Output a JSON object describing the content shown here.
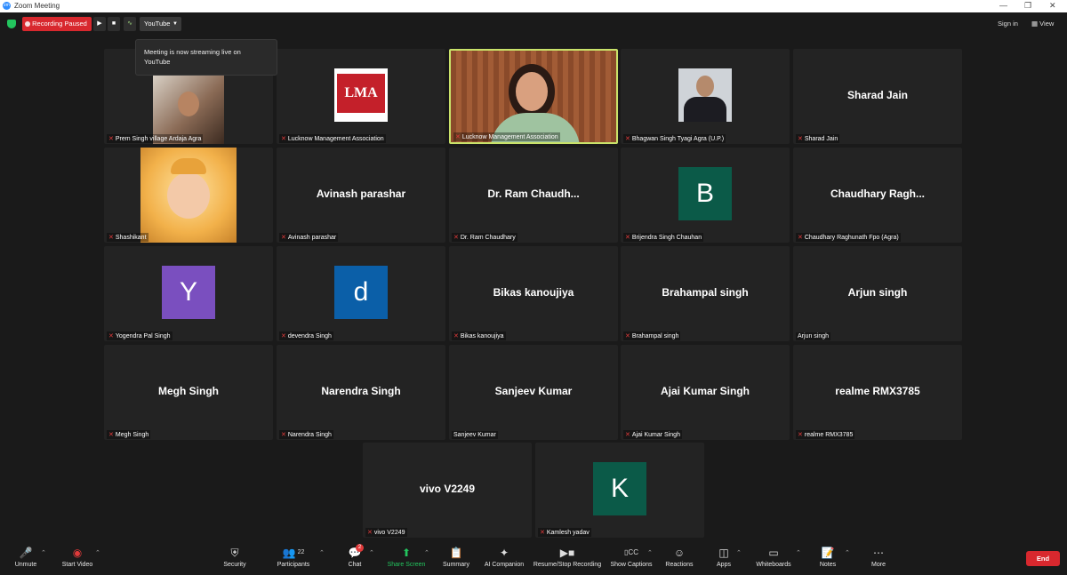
{
  "window": {
    "title": "Zoom Meeting",
    "app_icon": "zoom-icon",
    "app_icon_text": "zm"
  },
  "topbar": {
    "recording_label": "Recording Paused",
    "stream_target": "YouTube",
    "sign_in": "Sign in",
    "view": "View"
  },
  "tooltip": {
    "text": "Meeting is now streaming live on YouTube"
  },
  "tiles": [
    {
      "caption": "Prem Singh village Ardaja Agra",
      "big_name": "",
      "kind": "photo-man"
    },
    {
      "caption": "Lucknow Management Association",
      "big_name": "",
      "kind": "lma-logo",
      "logo_text": "LMA"
    },
    {
      "caption": "Lucknow Management Association",
      "big_name": "",
      "kind": "video-woman",
      "speaking": true
    },
    {
      "caption": "Bhagwan Singh Tyagi  Agra (U.P.)",
      "big_name": "",
      "kind": "photo-suit"
    },
    {
      "caption": "Sharad Jain",
      "big_name": "Sharad Jain"
    },
    {
      "caption": "Shashikant",
      "big_name": "",
      "kind": "photo-krishna"
    },
    {
      "caption": "Avinash parashar",
      "big_name": "Avinash parashar"
    },
    {
      "caption": "Dr. Ram Chaudhary",
      "big_name": "Dr. Ram  Chaudh..."
    },
    {
      "caption": "Brijendra Singh Chauhan",
      "big_name": "",
      "letter": "B",
      "letter_color": "#0b5a48"
    },
    {
      "caption": "Chaudhary Raghunath Fpo (Agra)",
      "big_name": "Chaudhary  Ragh..."
    },
    {
      "caption": "Yogendra Pal Singh",
      "big_name": "",
      "letter": "Y",
      "letter_color": "#7a4fbf"
    },
    {
      "caption": "devendra Singh",
      "big_name": "",
      "letter": "d",
      "letter_color": "#0b5fa8"
    },
    {
      "caption": "Bikas kanoujiya",
      "big_name": "Bikas kanoujiya"
    },
    {
      "caption": "Brahampal singh",
      "big_name": "Brahampal singh"
    },
    {
      "caption": "Arjun singh",
      "big_name": "Arjun singh",
      "no_mic": true
    },
    {
      "caption": "Megh Singh",
      "big_name": "Megh Singh"
    },
    {
      "caption": "Narendra Singh",
      "big_name": "Narendra Singh"
    },
    {
      "caption": "Sanjeev Kumar",
      "big_name": "Sanjeev Kumar",
      "no_mic": true
    },
    {
      "caption": "Ajai Kumar Singh",
      "big_name": "Ajai Kumar Singh"
    },
    {
      "caption": "realme RMX3785",
      "big_name": "realme RMX3785"
    },
    {
      "caption": "vivo V2249",
      "big_name": "vivo V2249"
    },
    {
      "caption": "Kamlesh yadav",
      "big_name": "",
      "letter": "K",
      "letter_color": "#0b5a48"
    }
  ],
  "toolbar": {
    "unmute": "Unmute",
    "start_video": "Start Video",
    "security": "Security",
    "participants": "Participants",
    "participants_count": "22",
    "chat": "Chat",
    "chat_badge": "2",
    "share_screen": "Share Screen",
    "summary": "Summary",
    "ai_companion": "AI Companion",
    "resume_stop_recording": "Resume/Stop Recording",
    "show_captions": "Show Captions",
    "reactions": "Reactions",
    "apps": "Apps",
    "whiteboards": "Whiteboards",
    "notes": "Notes",
    "more": "More",
    "end": "End"
  },
  "colors": {
    "accent_green": "#23c55e",
    "record_red": "#d8282e",
    "speaker_border": "#c9e26a"
  }
}
